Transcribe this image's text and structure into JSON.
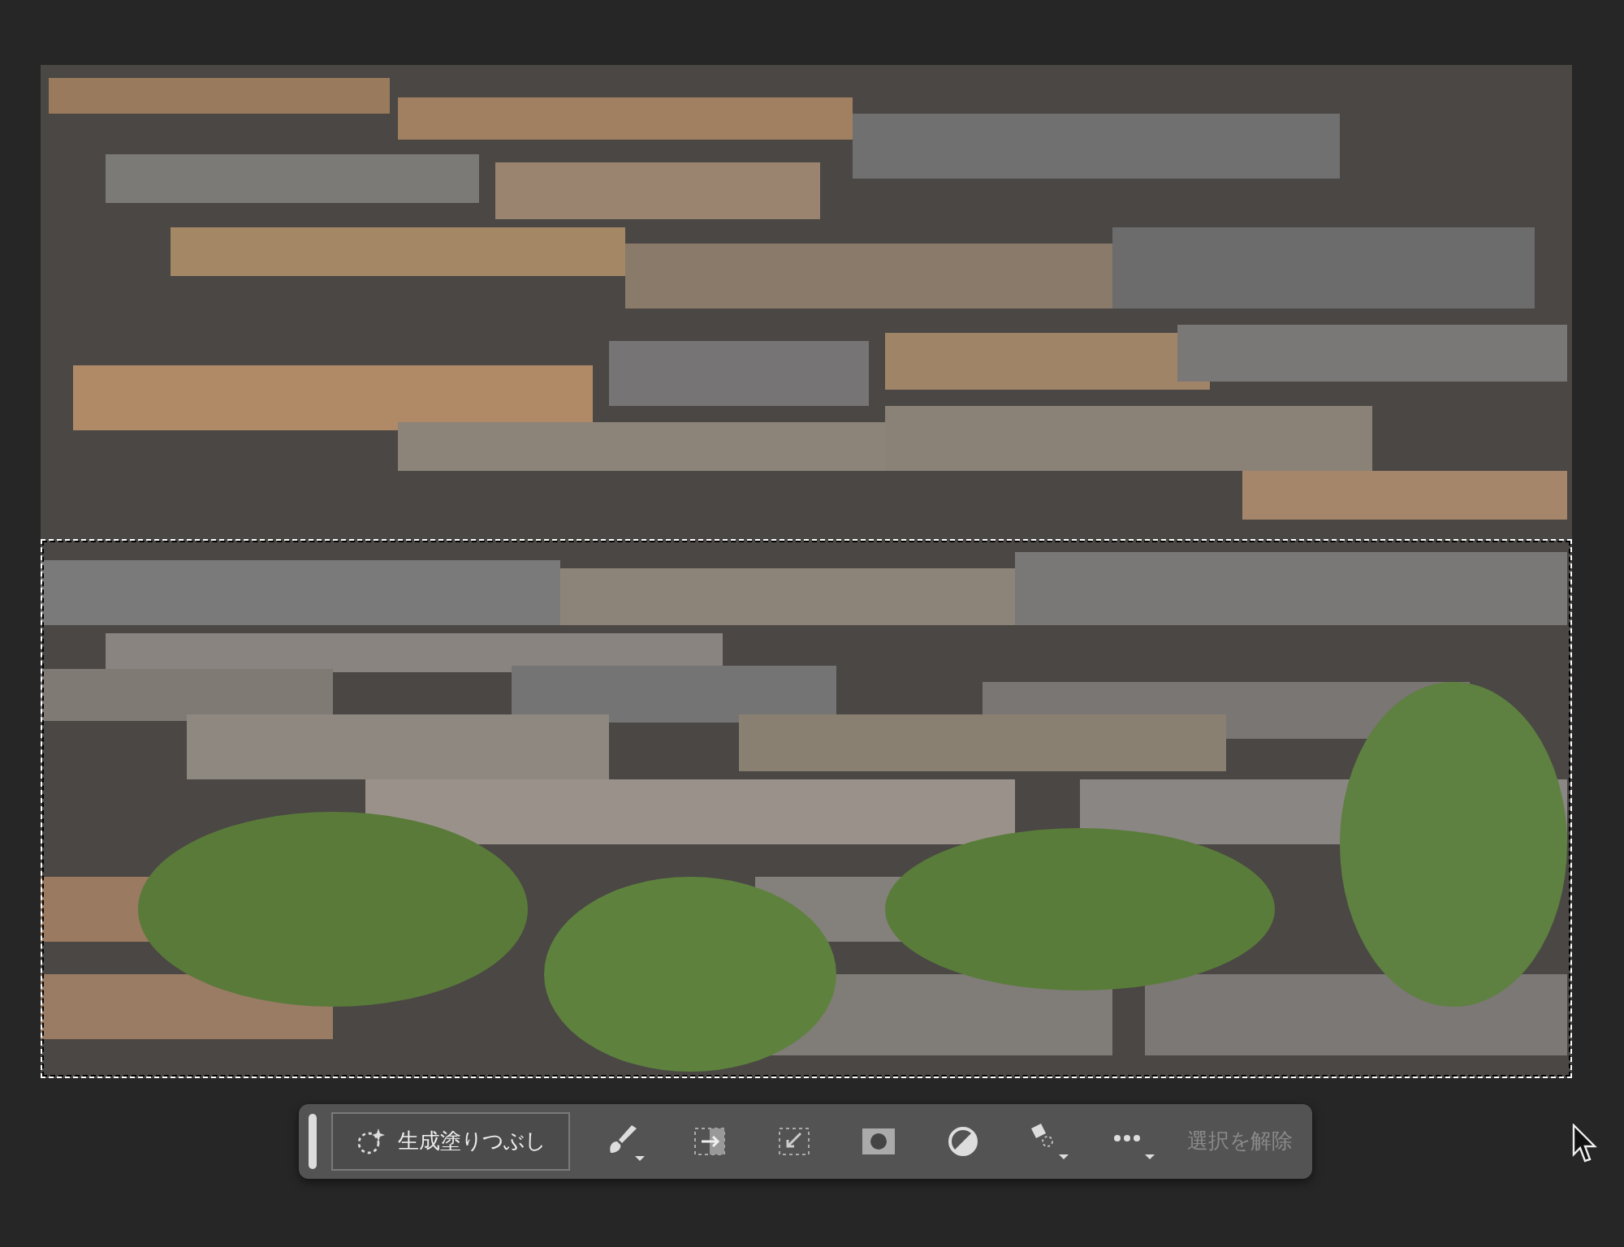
{
  "canvas": {
    "selection": {
      "active": true
    }
  },
  "taskbar": {
    "primary_button": {
      "label": "生成塗りつぶし"
    },
    "deselect": {
      "label": "選択を解除",
      "disabled": true
    }
  }
}
